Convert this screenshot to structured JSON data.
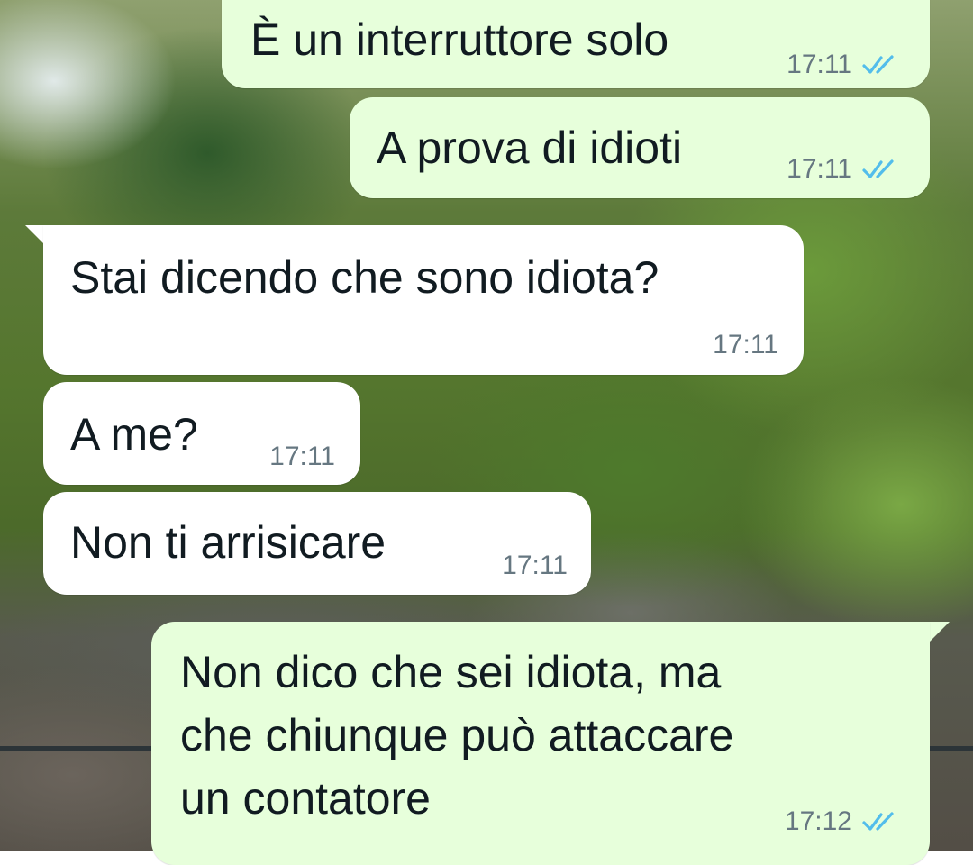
{
  "messages": [
    {
      "direction": "out",
      "text": "È un interruttore solo",
      "time": "17:11",
      "status": "read"
    },
    {
      "direction": "out",
      "text": "A prova di idioti",
      "time": "17:11",
      "status": "read"
    },
    {
      "direction": "in",
      "text": "Stai dicendo che sono idiota?",
      "time": "17:11"
    },
    {
      "direction": "in",
      "text": "A me?",
      "time": "17:11"
    },
    {
      "direction": "in",
      "text": "Non ti arrisicare",
      "time": "17:11"
    },
    {
      "direction": "out",
      "lines": [
        "Non dico che sei idiota, ma",
        "che chiunque può attaccare",
        "un contatore"
      ],
      "time": "17:12",
      "status": "read"
    }
  ],
  "colors": {
    "outgoing_bubble": "#e7ffdb",
    "incoming_bubble": "#ffffff",
    "text": "#111b21",
    "meta": "#667781",
    "read_ticks": "#53bdeb"
  },
  "icons": {
    "read_receipt": "double-check-icon"
  }
}
